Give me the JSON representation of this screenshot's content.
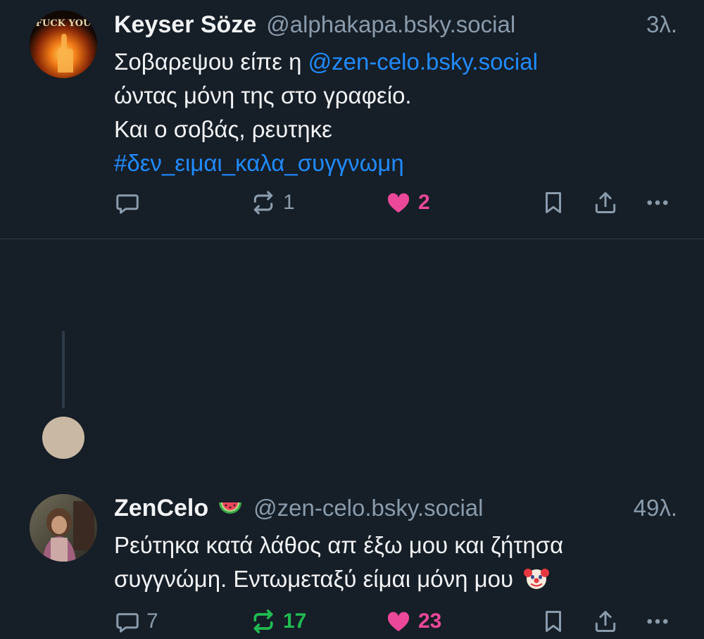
{
  "posts": [
    {
      "author": {
        "name": "Keyser Söze",
        "handle": "@alphakapa.bsky.social",
        "avatar_text": "FUCK YOU"
      },
      "time": "3λ.",
      "text": {
        "part1": "Σοβαρεψου είπε η ",
        "mention": "@zen-celo.bsky.social",
        "part2": "ώντας μόνη της στο γραφείο.",
        "part3": "Και ο σοβάς, ρευτηκε",
        "hashtag": "#δεν_ειμαι_καλα_συγγνωμη"
      },
      "actions": {
        "replies": "",
        "reposts": "1",
        "likes": "2"
      }
    },
    {
      "author": {
        "name": "ZenCelo",
        "name_emoji": "watermelon-emoji",
        "handle": "@zen-celo.bsky.social"
      },
      "time": "49λ.",
      "text": {
        "line1": "Ρεύτηκα κατά λάθος απ έξω μου και ζήτησα",
        "line2": "συγγνώμη. Εντωμεταξύ είμαι μόνη μου"
      },
      "actions": {
        "replies": "7",
        "reposts": "17",
        "likes": "23"
      }
    }
  ],
  "colors": {
    "background": "#161e27",
    "text": "#f1f3f5",
    "muted": "#8a9bab",
    "link": "#208bfe",
    "like": "#ec4899",
    "repost_active": "#20bc52",
    "divider": "#2e3a47"
  },
  "icons": [
    "reply-icon",
    "repost-icon",
    "heart-icon",
    "bookmark-icon",
    "share-icon",
    "more-icon",
    "clown-emoji",
    "watermelon-emoji"
  ]
}
